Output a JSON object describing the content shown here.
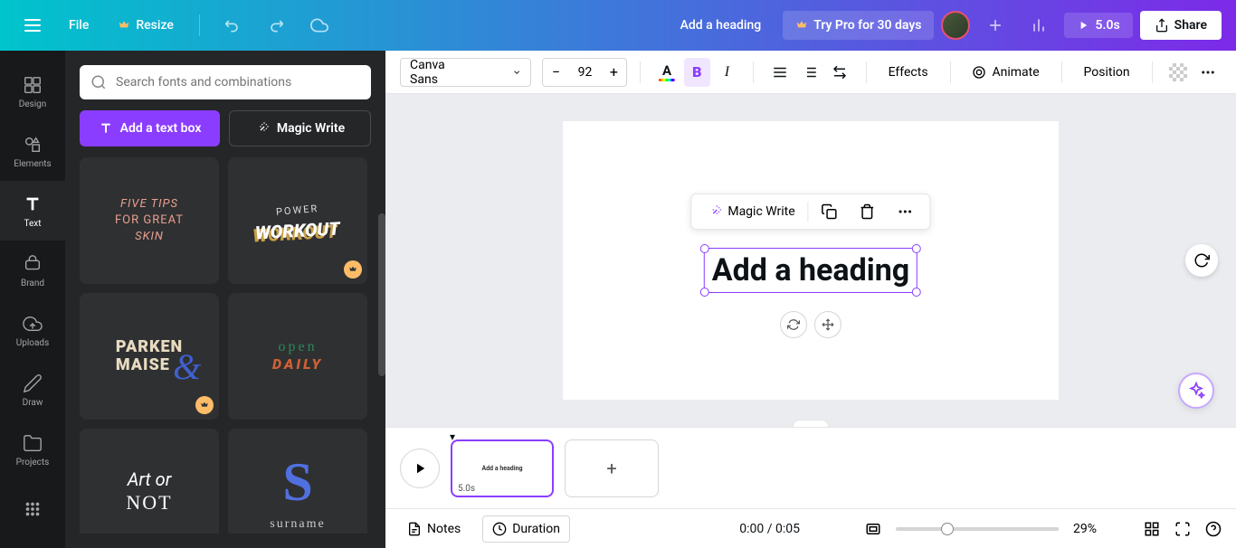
{
  "topbar": {
    "file": "File",
    "resize": "Resize",
    "doc_title": "Add a heading",
    "try_pro": "Try Pro for 30 days",
    "play_duration": "5.0s",
    "share": "Share"
  },
  "rail": {
    "design": "Design",
    "elements": "Elements",
    "text": "Text",
    "brand": "Brand",
    "uploads": "Uploads",
    "draw": "Draw",
    "projects": "Projects"
  },
  "panel": {
    "search_placeholder": "Search fonts and combinations",
    "add_text": "Add a text box",
    "magic_write": "Magic Write",
    "templates": {
      "t1_line1": "FIVE TIPS",
      "t1_line2": "FOR GREAT",
      "t1_line3": "SKIN",
      "t2_power": "POWER",
      "t2_workout": "WORKOUT",
      "t3_line1": "PARKEN",
      "t3_line2": "MAISE",
      "t4_open": "open",
      "t4_daily": "DAILY",
      "t5_line1": "Art or",
      "t5_line2": "NOT",
      "t6_s": "S",
      "t6_surname": "surname"
    }
  },
  "toolbar": {
    "font": "Canva Sans",
    "font_size": "92",
    "effects": "Effects",
    "animate": "Animate",
    "position": "Position"
  },
  "canvas": {
    "magic_write": "Magic Write",
    "heading_text": "Add a heading"
  },
  "timeline": {
    "thumb_text": "Add a heading",
    "thumb_duration": "5.0s"
  },
  "statusbar": {
    "notes": "Notes",
    "duration": "Duration",
    "time": "0:00 / 0:05",
    "zoom": "29%"
  }
}
